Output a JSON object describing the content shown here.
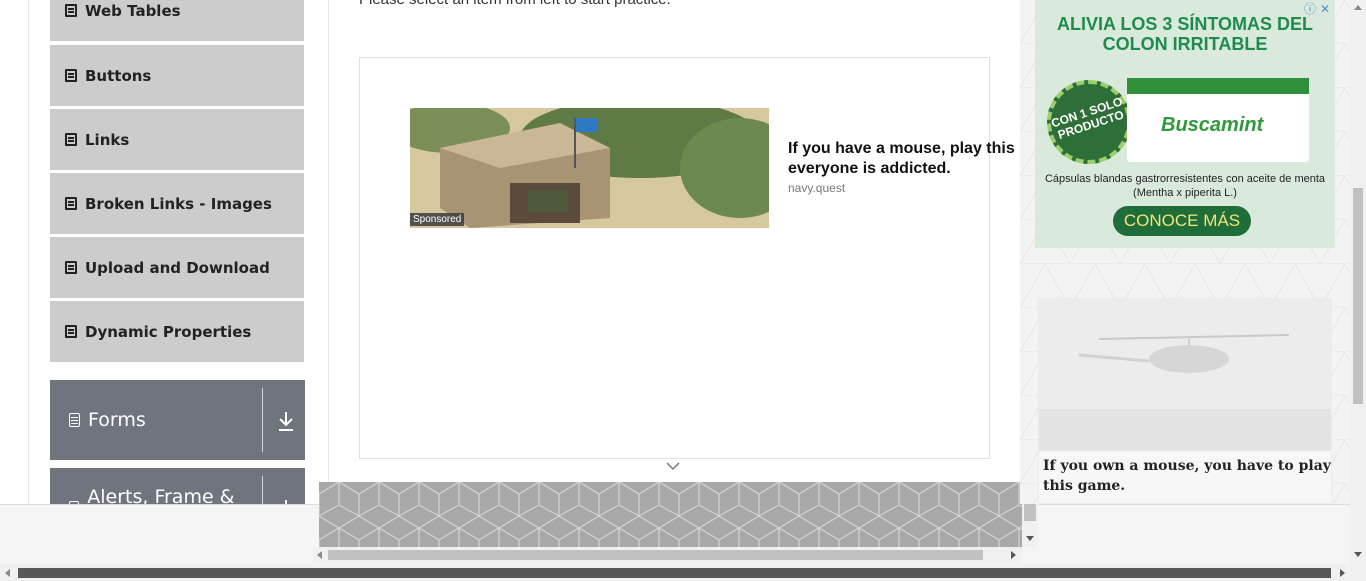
{
  "sidebar": {
    "items": [
      {
        "label": "Web Tables"
      },
      {
        "label": "Buttons"
      },
      {
        "label": "Links"
      },
      {
        "label": "Broken Links - Images"
      },
      {
        "label": "Upload and Download"
      },
      {
        "label": "Dynamic Properties"
      }
    ],
    "groups": [
      {
        "label": "Forms"
      },
      {
        "label": "Alerts, Frame & Windows"
      }
    ]
  },
  "main": {
    "instruction": "Please select an item from left to start practice."
  },
  "center_ad": {
    "sponsored_label": "Sponsored",
    "headline": "If you have a mouse, play this everyone is addicted.",
    "source": "navy.quest"
  },
  "right_ads": {
    "top_ad": {
      "headline": "ALIVIA LOS 3  SÍNTOMAS DEL COLON IRRITABLE",
      "seal_text": "CON 1 SOLO PRODUCTO",
      "brand": "Buscamint",
      "subtext": "Cápsulas blandas gastrorresistentes con aceite de menta (Mentha x piperita L.)",
      "cta": "CONOCE MÁS"
    },
    "second_ad": {
      "headline": "If you own a mouse, you have to play this game."
    }
  },
  "colors": {
    "menu_item_bg": "#cccccc",
    "group_header_bg": "#6e757c",
    "ad_green": "#1f8b4c"
  }
}
